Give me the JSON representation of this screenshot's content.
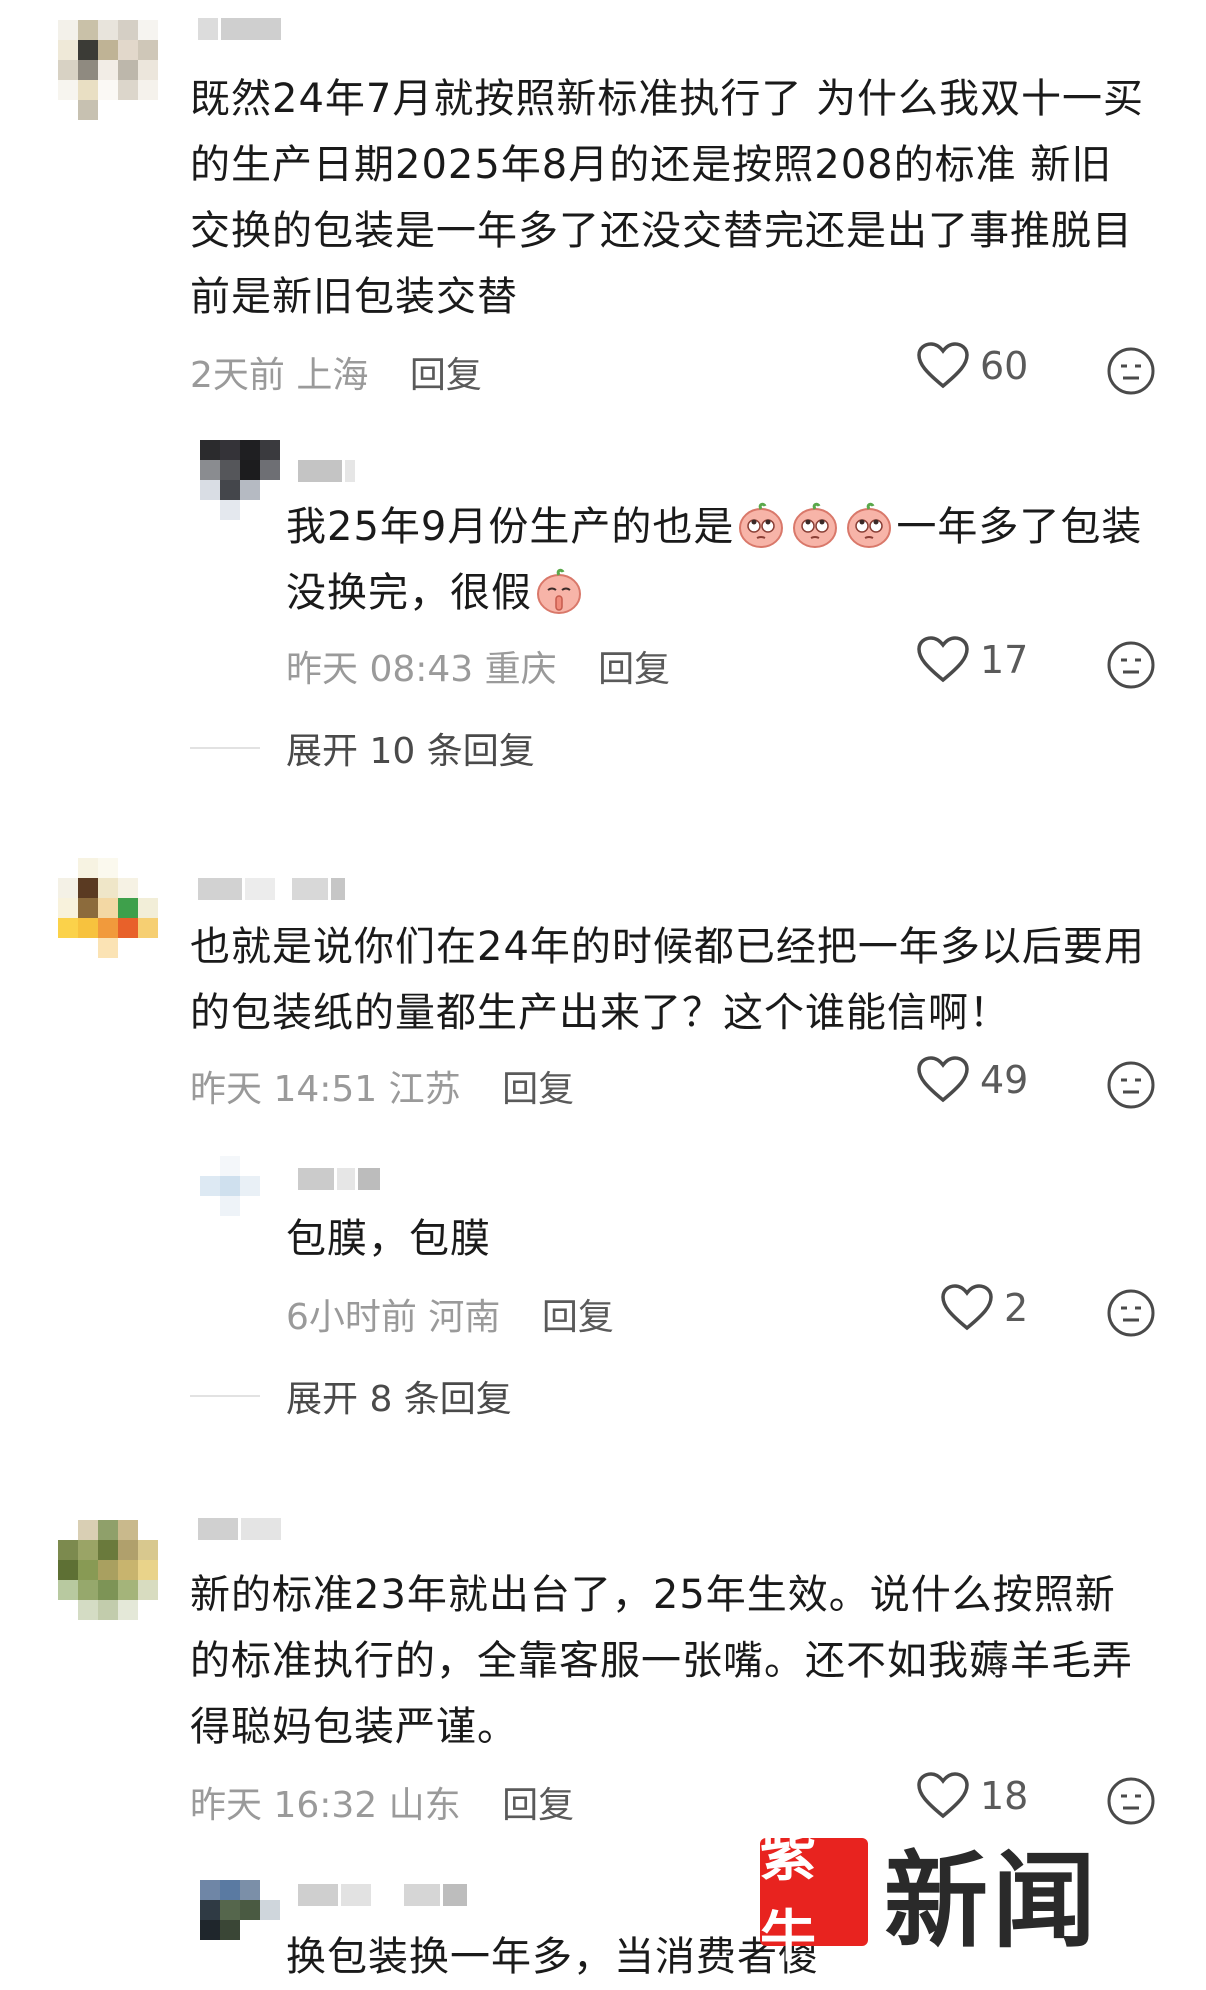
{
  "comments": [
    {
      "text": "既然24年7月就按照新标准执行了 为什么我双十一买的生产日期2025年8月的还是按照208的标准  新旧交换的包装是一年多了还没交替完还是出了事推脱目前是新旧包装交替",
      "time": "2天前",
      "location": "上海",
      "reply_label": "回复",
      "likes": "60",
      "replies": [
        {
          "text_before": "我25年9月份生产的也是",
          "text_after": "一年多了包装没换完，很假",
          "time": "昨天 08:43",
          "location": "重庆",
          "reply_label": "回复",
          "likes": "17"
        }
      ],
      "expand_label": "展开 10 条回复"
    },
    {
      "text": "也就是说你们在24年的时候都已经把一年多以后要用的包装纸的量都生产出来了？这个谁能信啊！",
      "time": "昨天 14:51",
      "location": "江苏",
      "reply_label": "回复",
      "likes": "49",
      "replies": [
        {
          "text": "包膜，包膜",
          "time": "6小时前",
          "location": "河南",
          "reply_label": "回复",
          "likes": "2"
        }
      ],
      "expand_label": "展开 8 条回复"
    },
    {
      "text": "新的标准23年就出台了，25年生效。说什么按照新的标准执行的，全靠客服一张嘴。还不如我薅羊毛弄得聪妈包装严谨。",
      "time": "昨天 16:32",
      "location": "山东",
      "reply_label": "回复",
      "likes": "18",
      "replies": [
        {
          "text": "换包装换一年多，当消费者傻"
        }
      ]
    }
  ],
  "watermark": {
    "badge": "紫牛",
    "word": "新闻"
  },
  "icons": {
    "like": "heart-outline-icon",
    "dislike": "neutral-face-icon",
    "emoji": "peach-eye-roll-emoji",
    "emoji_shush": "peach-shush-emoji"
  },
  "colors": {
    "meta_gray": "#9a9a9a",
    "text": "#1a1a1a",
    "brand_red": "#e8231f"
  }
}
